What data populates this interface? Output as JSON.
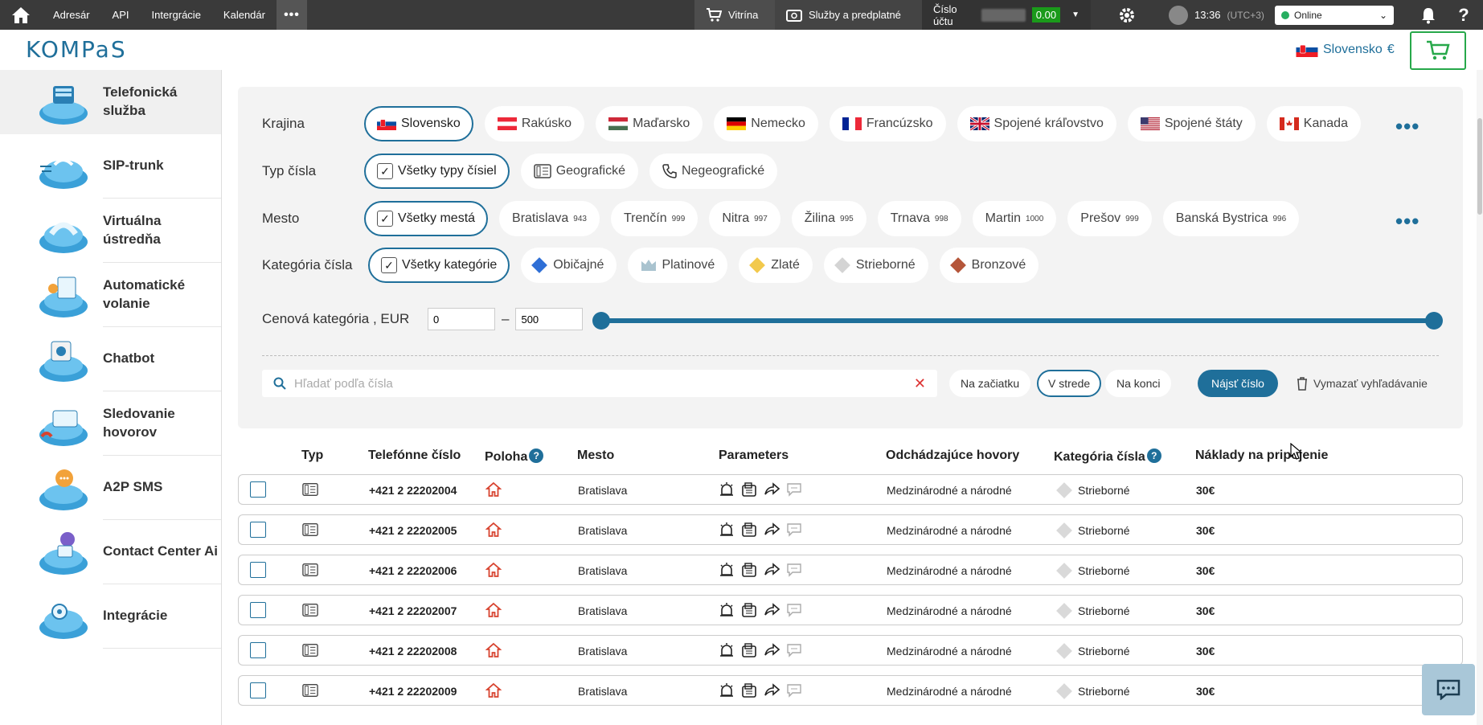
{
  "topbar": {
    "nav": [
      "Adresár",
      "API",
      "Intergrácie",
      "Kalendár"
    ],
    "vitrina": "Vitrína",
    "sluzby": "Služby a predplatné",
    "account_label": "Číslo účtu",
    "balance": "0.00",
    "time": "13:36",
    "timezone": "(UTC+3)",
    "status": "Online",
    "help": "?"
  },
  "header": {
    "logo": "KOMPaS",
    "country": "Slovensko",
    "currency": "€"
  },
  "sidebar": {
    "items": [
      {
        "label": "Telefonická služba",
        "icon": "phone-service-icon"
      },
      {
        "label": "SIP-trunk",
        "icon": "sip-trunk-icon"
      },
      {
        "label": "Virtuálna ústredňa",
        "icon": "virtual-pbx-icon"
      },
      {
        "label": "Automatické volanie",
        "icon": "auto-dial-icon"
      },
      {
        "label": "Chatbot",
        "icon": "chatbot-icon"
      },
      {
        "label": "Sledovanie hovorov",
        "icon": "call-tracking-icon"
      },
      {
        "label": "A2P SMS",
        "icon": "sms-icon"
      },
      {
        "label": "Contact Center Ai",
        "icon": "contact-center-icon"
      },
      {
        "label": "Integrácie",
        "icon": "integration-icon"
      }
    ]
  },
  "filters": {
    "country_label": "Krajina",
    "countries": [
      "Slovensko",
      "Rakúsko",
      "Maďarsko",
      "Nemecko",
      "Francúzsko",
      "Spojené kráľovstvo",
      "Spojené štáty",
      "Kanada"
    ],
    "type_label": "Typ čísla",
    "types": [
      "Všetky typy čísiel",
      "Geografické",
      "Negeografické"
    ],
    "city_label": "Mesto",
    "city_all": "Všetky mestá",
    "cities": [
      {
        "name": "Bratislava",
        "count": "943"
      },
      {
        "name": "Trenčín",
        "count": "999"
      },
      {
        "name": "Nitra",
        "count": "997"
      },
      {
        "name": "Žilina",
        "count": "995"
      },
      {
        "name": "Trnava",
        "count": "998"
      },
      {
        "name": "Martin",
        "count": "1000"
      },
      {
        "name": "Prešov",
        "count": "999"
      },
      {
        "name": "Banská Bystrica",
        "count": "996"
      }
    ],
    "category_label": "Kategória čísla",
    "categories": [
      "Všetky kategórie",
      "Običajné",
      "Platinové",
      "Zlaté",
      "Strieborné",
      "Bronzové"
    ],
    "category_colors": [
      "#2f6fd6",
      "#a9c3cf",
      "#f2c94c",
      "#cfcfcf",
      "#b5563a"
    ],
    "price_label": "Cenová kategória , EUR",
    "price_min": "0",
    "price_max": "500",
    "price_sep": "–",
    "search_placeholder": "Hľadať podľa čísla",
    "positions": [
      "Na začiatku",
      "V strede",
      "Na konci"
    ],
    "find": "Nájsť číslo",
    "clear": "Vymazať vyhľadávanie"
  },
  "table": {
    "headers": [
      "Typ",
      "Telefónne číslo",
      "Poloha",
      "Mesto",
      "Parameters",
      "Odchádzajúce hovory",
      "Kategória čísla",
      "Náklady na pripojenie"
    ],
    "rows": [
      {
        "number": "+421 2 22202004",
        "city": "Bratislava",
        "outgoing": "Medzinárodné a národné",
        "category": "Strieborné",
        "price": "30€"
      },
      {
        "number": "+421 2 22202005",
        "city": "Bratislava",
        "outgoing": "Medzinárodné a národné",
        "category": "Strieborné",
        "price": "30€"
      },
      {
        "number": "+421 2 22202006",
        "city": "Bratislava",
        "outgoing": "Medzinárodné a národné",
        "category": "Strieborné",
        "price": "30€"
      },
      {
        "number": "+421 2 22202007",
        "city": "Bratislava",
        "outgoing": "Medzinárodné a národné",
        "category": "Strieborné",
        "price": "30€"
      },
      {
        "number": "+421 2 22202008",
        "city": "Bratislava",
        "outgoing": "Medzinárodné a národné",
        "category": "Strieborné",
        "price": "30€"
      },
      {
        "number": "+421 2 22202009",
        "city": "Bratislava",
        "outgoing": "Medzinárodné a národné",
        "category": "Strieborné",
        "price": "30€"
      }
    ]
  },
  "colors": {
    "accent": "#1f6f9a",
    "topbar": "#3a3a3a",
    "cart_border": "#27a84a",
    "balance_bg": "#1a9a1a"
  }
}
